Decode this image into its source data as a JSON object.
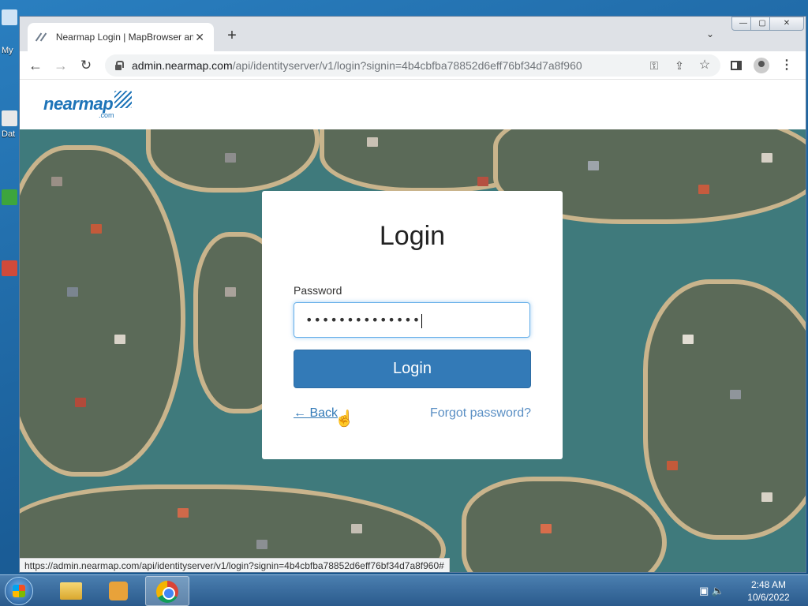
{
  "desktop": {
    "labels": [
      "My",
      "Dat"
    ]
  },
  "browser": {
    "tab_title": "Nearmap Login | MapBrowser an",
    "tab_close": "✕",
    "newtab": "+",
    "tab_dropdown": "⌄",
    "window_controls": {
      "minimize": "—",
      "maximize": "▢",
      "close": "✕"
    },
    "url_host": "admin.nearmap.com",
    "url_path": "/api/identityserver/v1/login?signin=4b4cbfba78852d6eff76bf34d7a8f960",
    "status_url": "https://admin.nearmap.com/api/identityserver/v1/login?signin=4b4cbfba78852d6eff76bf34d7a8f960#"
  },
  "page": {
    "logo_text": "nearmap",
    "logo_suffix": ".com",
    "login": {
      "title": "Login",
      "password_label": "Password",
      "password_value": "••••••••••••••",
      "submit_label": "Login",
      "back_label": "← Back",
      "forgot_label": "Forgot password?"
    }
  },
  "taskbar": {
    "time": "2:48 AM",
    "date": "10/6/2022"
  },
  "colors": {
    "primary": "#337ab7",
    "brand": "#1e74b8",
    "water": "#3f7a7c"
  },
  "icons": [
    "nearmap-favicon",
    "lock-icon",
    "key-icon",
    "share-icon",
    "star-icon",
    "side-panel-icon",
    "profile-icon",
    "menu-icon",
    "hand-cursor-icon",
    "windows-start-icon",
    "explorer-icon",
    "media-player-icon",
    "chrome-icon",
    "network-icon",
    "volume-icon"
  ]
}
